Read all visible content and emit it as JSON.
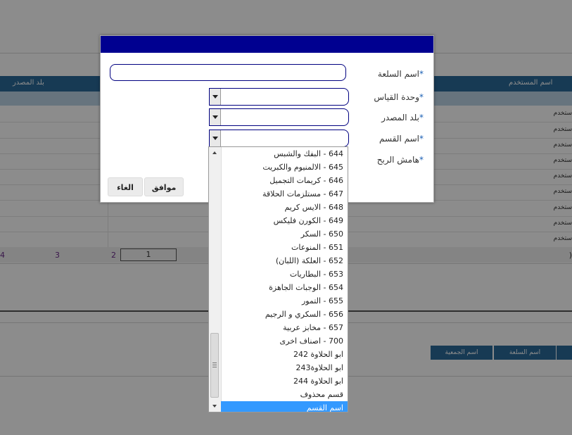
{
  "background": {
    "grid": {
      "header_left": "بلد المصدر",
      "header_right": "اسم المستخدم",
      "row_cell_text": "ستخدم"
    },
    "pager": {
      "pages": [
        "4",
        "3",
        "2"
      ],
      "current": "1",
      "right_text": ")"
    },
    "grid2": {
      "headers": [
        "اسم السلعة",
        "اسم الجمعية"
      ]
    }
  },
  "dialog": {
    "labels": {
      "item_name": "اسم السلعة",
      "unit": "وحدة القياس",
      "origin": "بلد المصدر",
      "section": "اسم القسم",
      "margin": "هامش الربح"
    },
    "required_mark": "*",
    "buttons": {
      "ok": "موافق",
      "cancel": "الغاء"
    }
  },
  "dropdown": {
    "options": [
      "644 - البفك والشبس",
      "645 - الالمنيوم والكبريت",
      "646 - كريمات التجميل",
      "647 - مستلزمات الحلاقة",
      "648 - الايس كريم",
      "649 - الكورن فليكس",
      "650 - السكر",
      "651 - المنوعات",
      "652 - العلكة (اللبان)",
      "653 - البطاريات",
      "654 - الوجبات الجاهزة",
      "655 - التمور",
      "656 - السكري و الرجيم",
      "657 - مخابز عربية",
      "700 - اصناف اخرى",
      "ابو الحلاوة 242",
      "ابو الحلاوة243",
      "ابو الحلاوة 244",
      "قسم محذوف",
      "اسم القسم"
    ],
    "selected": "اسم القسم",
    "selected_color": "#3399ff"
  },
  "colors": {
    "title_bar": "#000090",
    "header": "#2b6a99",
    "input_border": "#000080"
  }
}
